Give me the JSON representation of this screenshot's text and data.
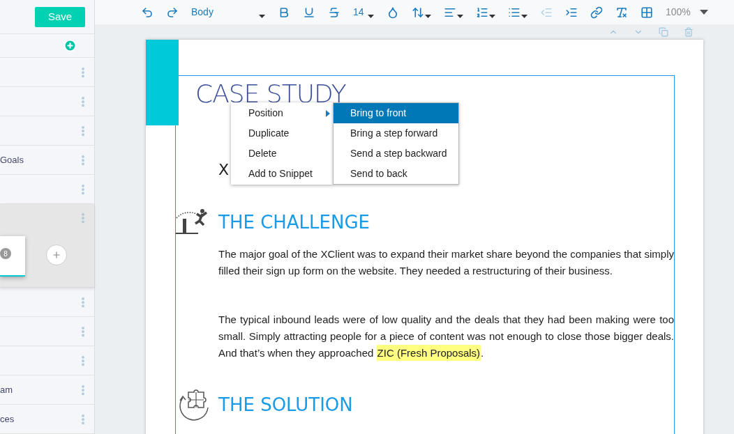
{
  "sidebar": {
    "save_button": "Save",
    "items": [
      {
        "selected": false
      },
      {
        "selected": false
      },
      {
        "selected": false
      },
      {
        "label": "Goals",
        "selected": false
      },
      {
        "selected": false
      },
      {
        "selected": true,
        "page_number": "8"
      },
      {
        "selected": false
      },
      {
        "selected": false
      },
      {
        "selected": false
      },
      {
        "label": "am",
        "selected": false
      },
      {
        "label": "ces",
        "selected": false
      }
    ]
  },
  "toolbar": {
    "items": [
      {
        "kind": "undo"
      },
      {
        "kind": "redo"
      },
      {
        "kind": "style",
        "text": "Body"
      },
      {
        "kind": "bold"
      },
      {
        "kind": "underline"
      },
      {
        "kind": "strike"
      },
      {
        "kind": "size",
        "text": "14"
      },
      {
        "kind": "font-color"
      },
      {
        "kind": "line-height"
      },
      {
        "kind": "align"
      },
      {
        "kind": "ordered-list"
      },
      {
        "kind": "bullet-list"
      },
      {
        "kind": "outdent",
        "disabled": true
      },
      {
        "kind": "indent",
        "disabled": false
      },
      {
        "kind": "link"
      },
      {
        "kind": "clear-format"
      },
      {
        "kind": "table"
      },
      {
        "kind": "zoom",
        "text": "100%"
      }
    ],
    "block_actions": [
      {
        "kind": "up"
      },
      {
        "kind": "down"
      },
      {
        "kind": "copy"
      },
      {
        "kind": "delete"
      }
    ]
  },
  "document": {
    "title": "CASE STUDY",
    "subtitle": "X",
    "sections": [
      {
        "heading": "THE CHALLENGE",
        "paragraphs": [
          [
            {
              "text": "The major goal of the XClient was to expand their market share beyond the companies that simply filled their sign up form on the website. They needed a restructuring of their business.",
              "highlighted": false
            }
          ],
          [
            {
              "text": "The typical inbound leads were of low quality and the deals that they had been making were too small. Simply attracting people for a piece of content was not enough to close those bigger deals. And that’s when they approached ",
              "highlighted": false
            },
            {
              "text": "ZIC (Fresh Proposals)",
              "highlighted": true
            },
            {
              "text": ".",
              "highlighted": false
            }
          ]
        ]
      },
      {
        "heading": "THE SOLUTION"
      }
    ]
  },
  "context_menu": {
    "items": [
      {
        "label": "Position",
        "has_submenu": true
      },
      {
        "label": "Duplicate",
        "has_submenu": false
      },
      {
        "label": "Delete",
        "has_submenu": false
      },
      {
        "label": "Add to Snippet",
        "has_submenu": false
      }
    ],
    "submenu": [
      {
        "label": "Bring to front",
        "selected": true
      },
      {
        "label": "Bring a step forward",
        "selected": false
      },
      {
        "label": "Send a step backward",
        "selected": false
      },
      {
        "label": "Send to back",
        "selected": false
      }
    ]
  }
}
